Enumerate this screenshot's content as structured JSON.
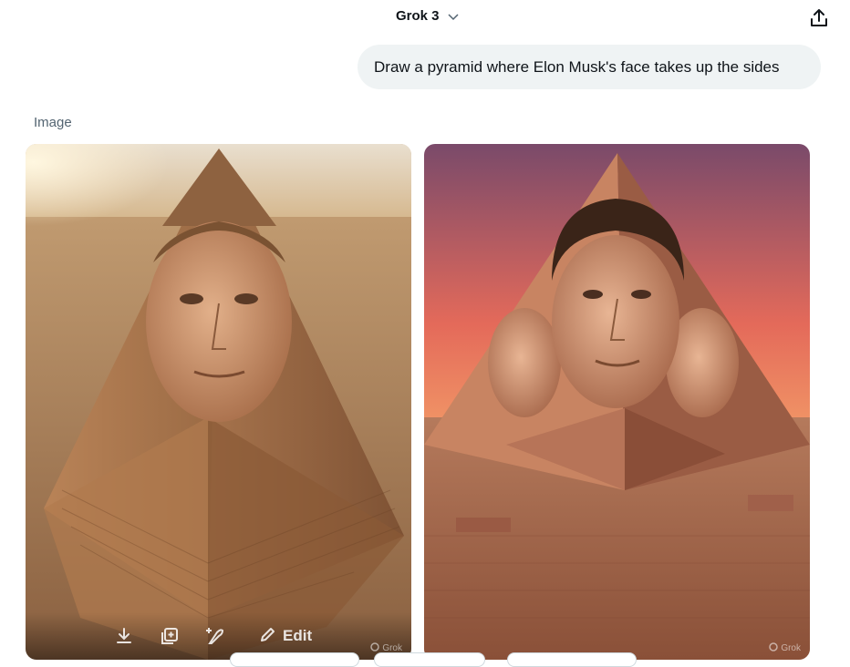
{
  "header": {
    "model_name": "Grok 3",
    "icons": {
      "model_dropdown": "chevron-down-icon",
      "share": "share-icon"
    }
  },
  "chat": {
    "user_message": "Draw a pyramid where Elon Musk's face takes up the sides",
    "response_section_label": "Image"
  },
  "images": [
    {
      "description_icon": "generated-image",
      "toolbar": {
        "download_icon": "download-icon",
        "copy_icon": "add-to-collection-icon",
        "variation_icon": "sparkle-pen-icon",
        "edit_label": "Edit"
      },
      "watermark": "Grok"
    },
    {
      "description_icon": "generated-image",
      "watermark": "Grok"
    }
  ],
  "colors": {
    "text_primary": "#0f1419",
    "text_secondary": "#536471",
    "bubble_bg": "#eff3f4"
  }
}
